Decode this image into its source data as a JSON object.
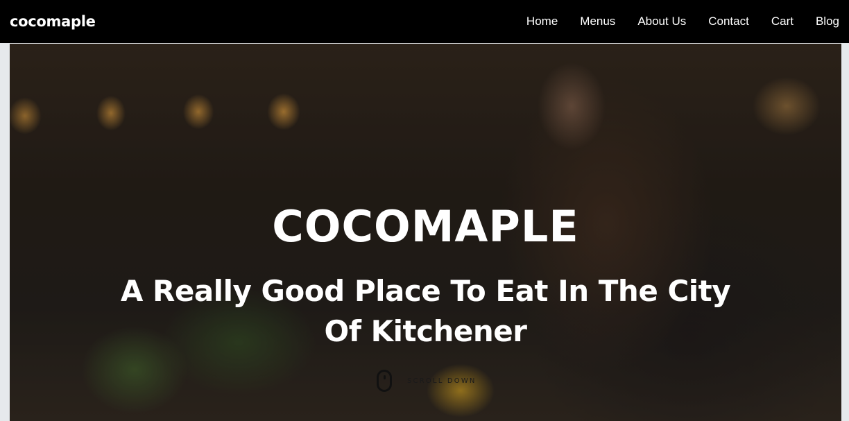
{
  "brand": {
    "name": "cocomaple"
  },
  "nav": {
    "items": [
      {
        "label": "Home"
      },
      {
        "label": "Menus"
      },
      {
        "label": "About Us"
      },
      {
        "label": "Contact"
      },
      {
        "label": "Cart"
      },
      {
        "label": "Blog"
      }
    ]
  },
  "hero": {
    "title": "COCOMAPLE",
    "subtitle": "A Really Good Place To Eat In The City Of Kitchener",
    "scroll_label": "SCROLL DOWN",
    "scroll_icon": "mouse-icon"
  },
  "colors": {
    "navbar_bg": "#000000",
    "nav_text": "#ffffff",
    "hero_text": "#ffffff",
    "page_bg": "#e6e9ec"
  }
}
